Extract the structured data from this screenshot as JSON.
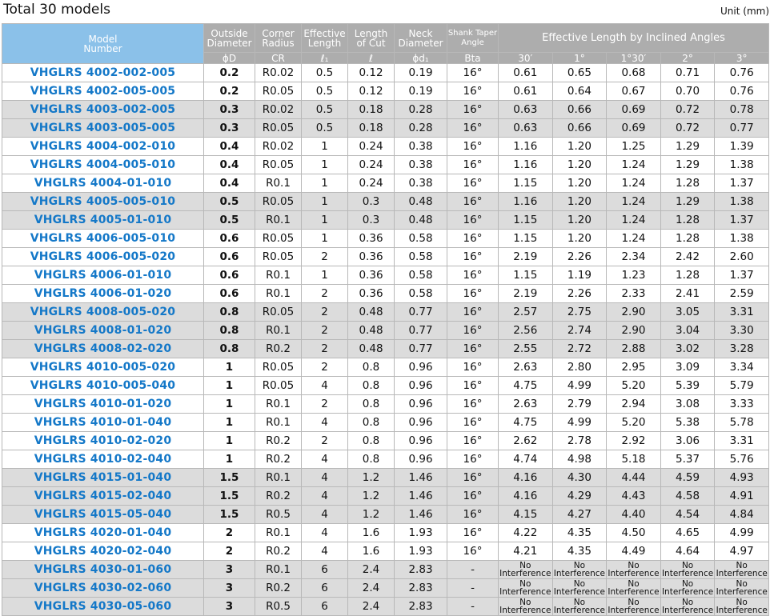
{
  "header": {
    "title": "Total 30 models",
    "unit": "Unit (mm)"
  },
  "columns": {
    "model": "Model\nNumber",
    "od_top": "Outside\nDiameter",
    "od_sym": "ϕD",
    "cr_top": "Corner\nRadius",
    "cr_sym": "CR",
    "el_top": "Effective\nLength",
    "el_sym": "ℓ₁",
    "lc_top": "Length\nof Cut",
    "lc_sym": "ℓ",
    "nd_top": "Neck\nDiameter",
    "nd_sym": "ϕd₁",
    "st_top": "Shank Taper\nAngle",
    "st_sym": "Bta",
    "angles_group": "Effective Length by Inclined Angles",
    "angles": [
      "30′",
      "1°",
      "1°30′",
      "2°",
      "3°"
    ]
  },
  "rows": [
    {
      "model": "VHGLRS 4002-002-005",
      "od": "0.2",
      "cr": "R0.02",
      "el": "0.5",
      "lc": "0.12",
      "nd": "0.19",
      "st": "16°",
      "a": [
        "0.61",
        "0.65",
        "0.68",
        "0.71",
        "0.76"
      ],
      "shade": false
    },
    {
      "model": "VHGLRS 4002-005-005",
      "od": "0.2",
      "cr": "R0.05",
      "el": "0.5",
      "lc": "0.12",
      "nd": "0.19",
      "st": "16°",
      "a": [
        "0.61",
        "0.64",
        "0.67",
        "0.70",
        "0.76"
      ],
      "shade": false
    },
    {
      "model": "VHGLRS 4003-002-005",
      "od": "0.3",
      "cr": "R0.02",
      "el": "0.5",
      "lc": "0.18",
      "nd": "0.28",
      "st": "16°",
      "a": [
        "0.63",
        "0.66",
        "0.69",
        "0.72",
        "0.78"
      ],
      "shade": true
    },
    {
      "model": "VHGLRS 4003-005-005",
      "od": "0.3",
      "cr": "R0.05",
      "el": "0.5",
      "lc": "0.18",
      "nd": "0.28",
      "st": "16°",
      "a": [
        "0.63",
        "0.66",
        "0.69",
        "0.72",
        "0.77"
      ],
      "shade": true
    },
    {
      "model": "VHGLRS 4004-002-010",
      "od": "0.4",
      "cr": "R0.02",
      "el": "1",
      "lc": "0.24",
      "nd": "0.38",
      "st": "16°",
      "a": [
        "1.16",
        "1.20",
        "1.25",
        "1.29",
        "1.39"
      ],
      "shade": false
    },
    {
      "model": "VHGLRS 4004-005-010",
      "od": "0.4",
      "cr": "R0.05",
      "el": "1",
      "lc": "0.24",
      "nd": "0.38",
      "st": "16°",
      "a": [
        "1.16",
        "1.20",
        "1.24",
        "1.29",
        "1.38"
      ],
      "shade": false
    },
    {
      "model": "VHGLRS 4004-01-010",
      "od": "0.4",
      "cr": "R0.1",
      "el": "1",
      "lc": "0.24",
      "nd": "0.38",
      "st": "16°",
      "a": [
        "1.15",
        "1.20",
        "1.24",
        "1.28",
        "1.37"
      ],
      "shade": false
    },
    {
      "model": "VHGLRS 4005-005-010",
      "od": "0.5",
      "cr": "R0.05",
      "el": "1",
      "lc": "0.3",
      "nd": "0.48",
      "st": "16°",
      "a": [
        "1.16",
        "1.20",
        "1.24",
        "1.29",
        "1.38"
      ],
      "shade": true
    },
    {
      "model": "VHGLRS 4005-01-010",
      "od": "0.5",
      "cr": "R0.1",
      "el": "1",
      "lc": "0.3",
      "nd": "0.48",
      "st": "16°",
      "a": [
        "1.15",
        "1.20",
        "1.24",
        "1.28",
        "1.37"
      ],
      "shade": true
    },
    {
      "model": "VHGLRS 4006-005-010",
      "od": "0.6",
      "cr": "R0.05",
      "el": "1",
      "lc": "0.36",
      "nd": "0.58",
      "st": "16°",
      "a": [
        "1.15",
        "1.20",
        "1.24",
        "1.28",
        "1.38"
      ],
      "shade": false
    },
    {
      "model": "VHGLRS 4006-005-020",
      "od": "0.6",
      "cr": "R0.05",
      "el": "2",
      "lc": "0.36",
      "nd": "0.58",
      "st": "16°",
      "a": [
        "2.19",
        "2.26",
        "2.34",
        "2.42",
        "2.60"
      ],
      "shade": false
    },
    {
      "model": "VHGLRS 4006-01-010",
      "od": "0.6",
      "cr": "R0.1",
      "el": "1",
      "lc": "0.36",
      "nd": "0.58",
      "st": "16°",
      "a": [
        "1.15",
        "1.19",
        "1.23",
        "1.28",
        "1.37"
      ],
      "shade": false
    },
    {
      "model": "VHGLRS 4006-01-020",
      "od": "0.6",
      "cr": "R0.1",
      "el": "2",
      "lc": "0.36",
      "nd": "0.58",
      "st": "16°",
      "a": [
        "2.19",
        "2.26",
        "2.33",
        "2.41",
        "2.59"
      ],
      "shade": false
    },
    {
      "model": "VHGLRS 4008-005-020",
      "od": "0.8",
      "cr": "R0.05",
      "el": "2",
      "lc": "0.48",
      "nd": "0.77",
      "st": "16°",
      "a": [
        "2.57",
        "2.75",
        "2.90",
        "3.05",
        "3.31"
      ],
      "shade": true
    },
    {
      "model": "VHGLRS 4008-01-020",
      "od": "0.8",
      "cr": "R0.1",
      "el": "2",
      "lc": "0.48",
      "nd": "0.77",
      "st": "16°",
      "a": [
        "2.56",
        "2.74",
        "2.90",
        "3.04",
        "3.30"
      ],
      "shade": true
    },
    {
      "model": "VHGLRS 4008-02-020",
      "od": "0.8",
      "cr": "R0.2",
      "el": "2",
      "lc": "0.48",
      "nd": "0.77",
      "st": "16°",
      "a": [
        "2.55",
        "2.72",
        "2.88",
        "3.02",
        "3.28"
      ],
      "shade": true
    },
    {
      "model": "VHGLRS 4010-005-020",
      "od": "1",
      "cr": "R0.05",
      "el": "2",
      "lc": "0.8",
      "nd": "0.96",
      "st": "16°",
      "a": [
        "2.63",
        "2.80",
        "2.95",
        "3.09",
        "3.34"
      ],
      "shade": false
    },
    {
      "model": "VHGLRS 4010-005-040",
      "od": "1",
      "cr": "R0.05",
      "el": "4",
      "lc": "0.8",
      "nd": "0.96",
      "st": "16°",
      "a": [
        "4.75",
        "4.99",
        "5.20",
        "5.39",
        "5.79"
      ],
      "shade": false
    },
    {
      "model": "VHGLRS 4010-01-020",
      "od": "1",
      "cr": "R0.1",
      "el": "2",
      "lc": "0.8",
      "nd": "0.96",
      "st": "16°",
      "a": [
        "2.63",
        "2.79",
        "2.94",
        "3.08",
        "3.33"
      ],
      "shade": false
    },
    {
      "model": "VHGLRS 4010-01-040",
      "od": "1",
      "cr": "R0.1",
      "el": "4",
      "lc": "0.8",
      "nd": "0.96",
      "st": "16°",
      "a": [
        "4.75",
        "4.99",
        "5.20",
        "5.38",
        "5.78"
      ],
      "shade": false
    },
    {
      "model": "VHGLRS 4010-02-020",
      "od": "1",
      "cr": "R0.2",
      "el": "2",
      "lc": "0.8",
      "nd": "0.96",
      "st": "16°",
      "a": [
        "2.62",
        "2.78",
        "2.92",
        "3.06",
        "3.31"
      ],
      "shade": false
    },
    {
      "model": "VHGLRS 4010-02-040",
      "od": "1",
      "cr": "R0.2",
      "el": "4",
      "lc": "0.8",
      "nd": "0.96",
      "st": "16°",
      "a": [
        "4.74",
        "4.98",
        "5.18",
        "5.37",
        "5.76"
      ],
      "shade": false
    },
    {
      "model": "VHGLRS 4015-01-040",
      "od": "1.5",
      "cr": "R0.1",
      "el": "4",
      "lc": "1.2",
      "nd": "1.46",
      "st": "16°",
      "a": [
        "4.16",
        "4.30",
        "4.44",
        "4.59",
        "4.93"
      ],
      "shade": true
    },
    {
      "model": "VHGLRS 4015-02-040",
      "od": "1.5",
      "cr": "R0.2",
      "el": "4",
      "lc": "1.2",
      "nd": "1.46",
      "st": "16°",
      "a": [
        "4.16",
        "4.29",
        "4.43",
        "4.58",
        "4.91"
      ],
      "shade": true
    },
    {
      "model": "VHGLRS 4015-05-040",
      "od": "1.5",
      "cr": "R0.5",
      "el": "4",
      "lc": "1.2",
      "nd": "1.46",
      "st": "16°",
      "a": [
        "4.15",
        "4.27",
        "4.40",
        "4.54",
        "4.84"
      ],
      "shade": true
    },
    {
      "model": "VHGLRS 4020-01-040",
      "od": "2",
      "cr": "R0.1",
      "el": "4",
      "lc": "1.6",
      "nd": "1.93",
      "st": "16°",
      "a": [
        "4.22",
        "4.35",
        "4.50",
        "4.65",
        "4.99"
      ],
      "shade": false
    },
    {
      "model": "VHGLRS 4020-02-040",
      "od": "2",
      "cr": "R0.2",
      "el": "4",
      "lc": "1.6",
      "nd": "1.93",
      "st": "16°",
      "a": [
        "4.21",
        "4.35",
        "4.49",
        "4.64",
        "4.97"
      ],
      "shade": false
    },
    {
      "model": "VHGLRS 4030-01-060",
      "od": "3",
      "cr": "R0.1",
      "el": "6",
      "lc": "2.4",
      "nd": "2.83",
      "st": "-",
      "a": [
        "No Interference",
        "No Interference",
        "No Interference",
        "No Interference",
        "No Interference"
      ],
      "shade": true
    },
    {
      "model": "VHGLRS 4030-02-060",
      "od": "3",
      "cr": "R0.2",
      "el": "6",
      "lc": "2.4",
      "nd": "2.83",
      "st": "-",
      "a": [
        "No Interference",
        "No Interference",
        "No Interference",
        "No Interference",
        "No Interference"
      ],
      "shade": true
    },
    {
      "model": "VHGLRS 4030-05-060",
      "od": "3",
      "cr": "R0.5",
      "el": "6",
      "lc": "2.4",
      "nd": "2.83",
      "st": "-",
      "a": [
        "No Interference",
        "No Interference",
        "No Interference",
        "No Interference",
        "No Interference"
      ],
      "shade": true
    }
  ],
  "colors": {
    "model_text": "#1478c8",
    "model_header_bg": "#8bc1e9",
    "header_bg": "#adadad",
    "row_shade": "#dcdcdc"
  }
}
